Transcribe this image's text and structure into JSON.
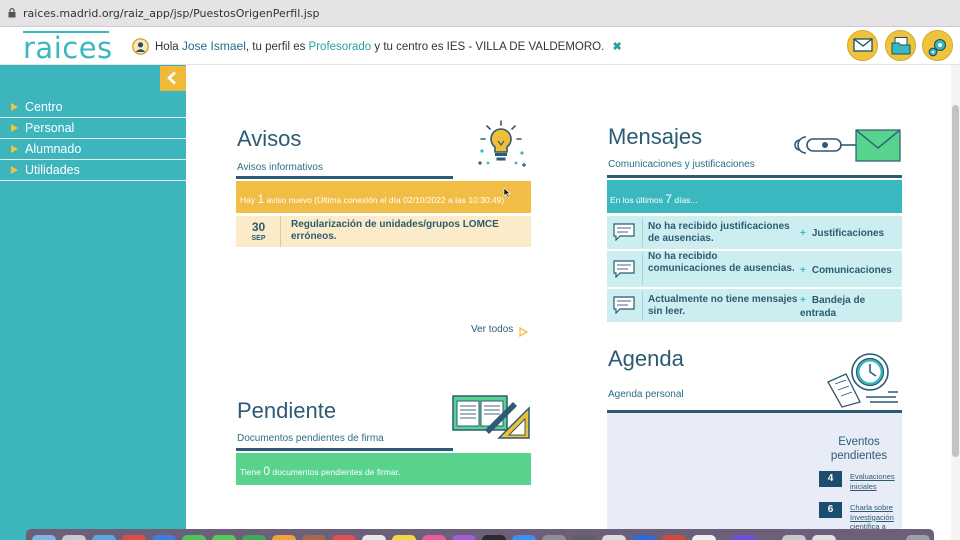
{
  "browser": {
    "url": "raices.madrid.org/raiz_app/jsp/PuestosOrigenPerfil.jsp"
  },
  "header": {
    "logo_text": "raices",
    "greeting_prefix": "Hola",
    "user_name": "Jose Ismael",
    "profile_mid": ", tu perfil es",
    "profile": "Profesorado",
    "center_mid": "y tu centro es",
    "center": "IES - VILLA DE VALDEMORO.",
    "buttons": [
      "mail-icon",
      "folder-icon",
      "settings-icon"
    ]
  },
  "sidebar": {
    "items": [
      {
        "label": "Centro"
      },
      {
        "label": "Personal"
      },
      {
        "label": "Alumnado"
      },
      {
        "label": "Utilidades"
      }
    ]
  },
  "avisos": {
    "title": "Avisos",
    "subtitle": "Avisos informativos",
    "bar_prefix": "Hay",
    "count": "1",
    "bar_suffix": "aviso nuevo (Última conexión el día 02/10/2022 a las 10:30:49)",
    "item": {
      "day": "30",
      "month": "SEP",
      "text": "Regularización de unidades/grupos LOMCE erróneos."
    },
    "ver_todos": "Ver todos"
  },
  "pendiente": {
    "title": "Pendiente",
    "subtitle": "Documentos pendientes de firma",
    "bar_prefix": "Tiene",
    "count": "0",
    "bar_suffix": "documentos pendientes de firmar."
  },
  "mensajes": {
    "title": "Mensajes",
    "subtitle": "Comunicaciones y justificaciones",
    "bar_prefix": "En los últimos",
    "days": "7",
    "bar_suffix": "días...",
    "rows": [
      {
        "text": "No ha recibido justificaciones de ausencias.",
        "link": "Justificaciones"
      },
      {
        "text": "No ha recibido comunicaciones de ausencias.",
        "link": "Comunicaciones"
      },
      {
        "text": "Actualmente no tiene mensajes sin leer.",
        "link": "Bandeja de entrada"
      }
    ]
  },
  "agenda": {
    "title": "Agenda",
    "subtitle": "Agenda personal",
    "eventos_title": "Eventos pendientes",
    "events": [
      {
        "count": "4",
        "label": "Evaluaciones iniciales"
      },
      {
        "count": "6",
        "label": "Charla sobre Investigación científica a"
      }
    ]
  },
  "colors": {
    "teal": "#3cb5bd",
    "yellow": "#f2bd44",
    "green": "#58d38e",
    "navy": "#2c5b73"
  }
}
